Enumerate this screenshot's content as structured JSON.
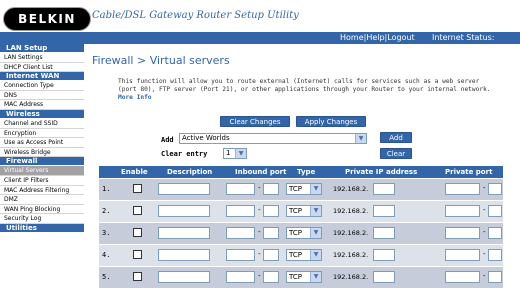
{
  "brand": {
    "logo_text": "BELKIN",
    "app_title": "Cable/DSL Gateway Router Setup Utility"
  },
  "topbar": {
    "links": "Home|Help|Logout",
    "status_label": "Internet Status:"
  },
  "sidebar": {
    "sections": [
      {
        "title": "LAN Setup",
        "items": [
          "LAN Settings",
          "DHCP Client List"
        ]
      },
      {
        "title": "Internet WAN",
        "items": [
          "Connection Type",
          "DNS",
          "MAC Address"
        ]
      },
      {
        "title": "Wireless",
        "items": [
          "Channel and SSID",
          "Encryption",
          "Use as Access Point",
          "Wireless Bridge"
        ]
      },
      {
        "title": "Firewall",
        "items": [
          "Virtual Servers",
          "Client IP Filters",
          "MAC Address Filtering",
          "DMZ",
          "WAN Ping Blocking",
          "Security Log"
        ]
      },
      {
        "title": "Utilities",
        "items": []
      }
    ],
    "selected_item": "Virtual Servers"
  },
  "main": {
    "title": "Firewall > Virtual servers",
    "description": "This function will allow you to route external (Internet) calls for services such as a web server (port 80), FTP server (Port 21), or other applications through your Router to your internal network.",
    "more_info": "More Info",
    "clear_changes": "Clear Changes",
    "apply_changes": "Apply Changes",
    "add_label": "Add",
    "add_select_value": "Active Worlds",
    "add_button": "Add",
    "clear_entry_label": "Clear entry",
    "clear_entry_value": "1",
    "clear_button": "Clear"
  },
  "table": {
    "headers": [
      "Enable",
      "Description",
      "Inbound port",
      "Type",
      "Private IP address",
      "Private port"
    ],
    "rows": [
      {
        "num": "1.",
        "type": "TCP",
        "ip_prefix": "192.168.2."
      },
      {
        "num": "2.",
        "type": "TCP",
        "ip_prefix": "192.168.2."
      },
      {
        "num": "3.",
        "type": "TCP",
        "ip_prefix": "192.168.2."
      },
      {
        "num": "4.",
        "type": "TCP",
        "ip_prefix": "192.168.2."
      },
      {
        "num": "5.",
        "type": "TCP",
        "ip_prefix": "192.168.2."
      }
    ]
  },
  "colors": {
    "brand_blue": "#3366a8",
    "row_odd": "#c6ccda",
    "row_even": "#dde1ea"
  }
}
